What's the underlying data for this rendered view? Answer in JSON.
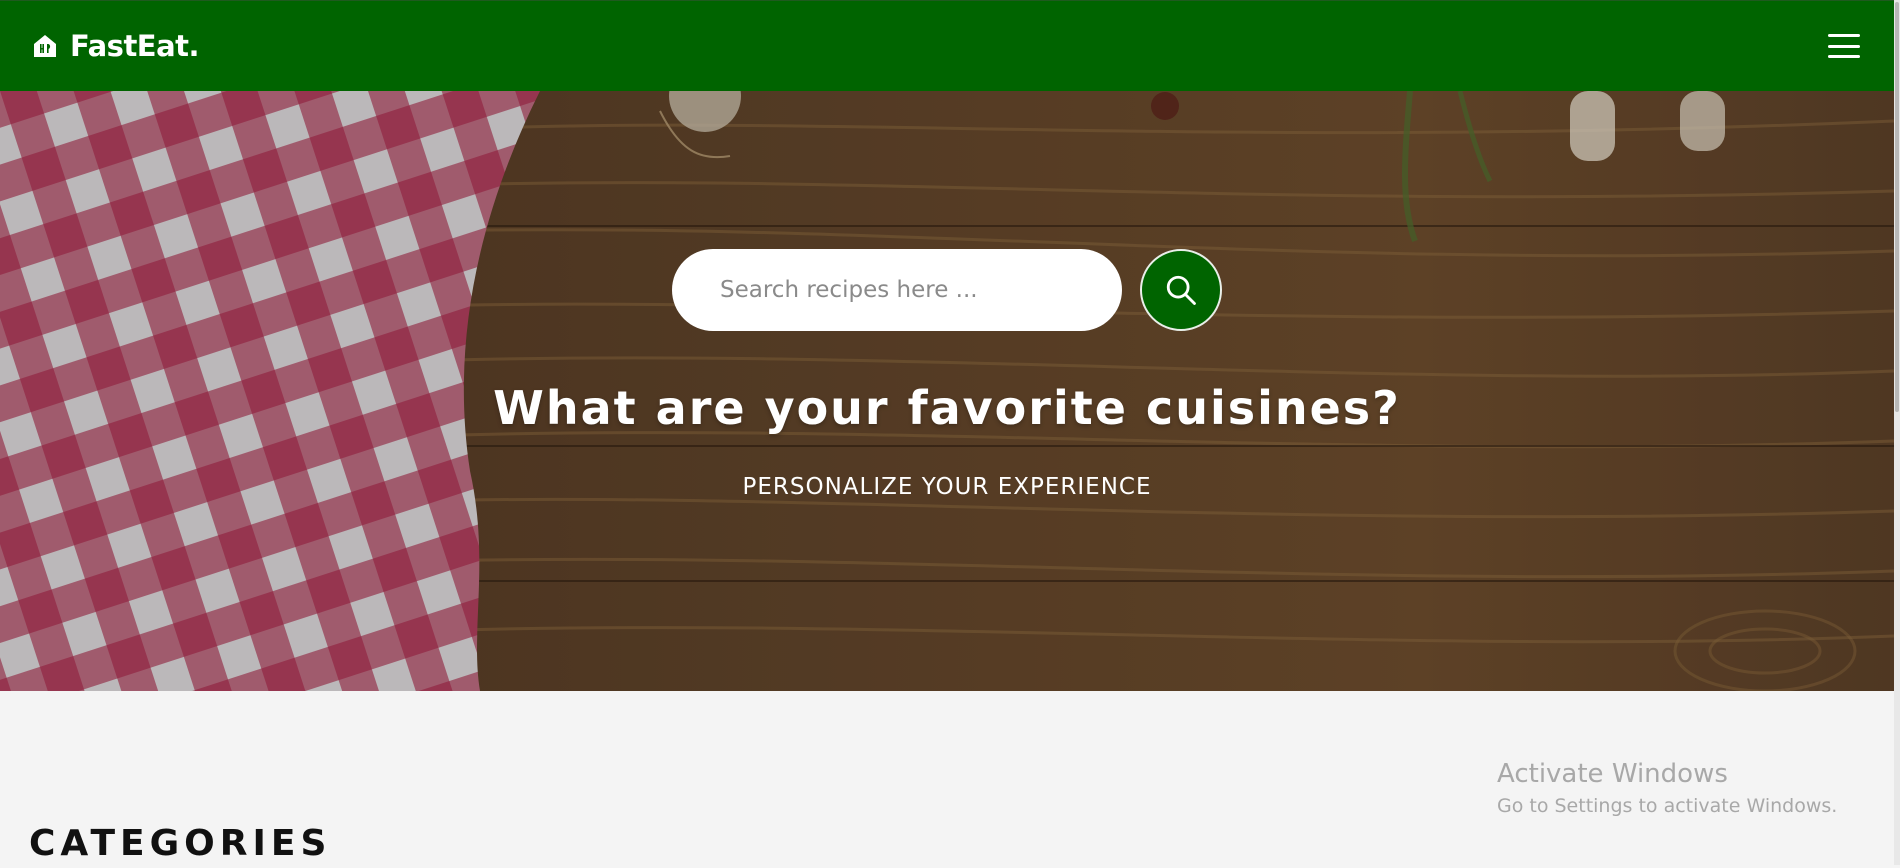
{
  "header": {
    "brand_name": "FastEat.",
    "brand_icon": "home-cutlery-icon",
    "menu_icon": "hamburger-menu-icon",
    "background_color": "#006400"
  },
  "hero": {
    "search": {
      "placeholder": "Search recipes here ...",
      "value": "",
      "button_icon": "search-icon"
    },
    "title": "What are your favorite cuisines?",
    "subtitle": "PERSONALIZE YOUR EXPERIENCE",
    "background_image": "checkered tablecloth on wooden table with herbs and mushrooms"
  },
  "main": {
    "section_title": "CATEGORIES"
  },
  "os_overlay": {
    "title": "Activate Windows",
    "message": "Go to Settings to activate Windows."
  },
  "colors": {
    "primary_green": "#006400",
    "page_background": "#f4f4f4",
    "text_dark": "#111111",
    "watermark_gray": "#a8a8a8"
  }
}
